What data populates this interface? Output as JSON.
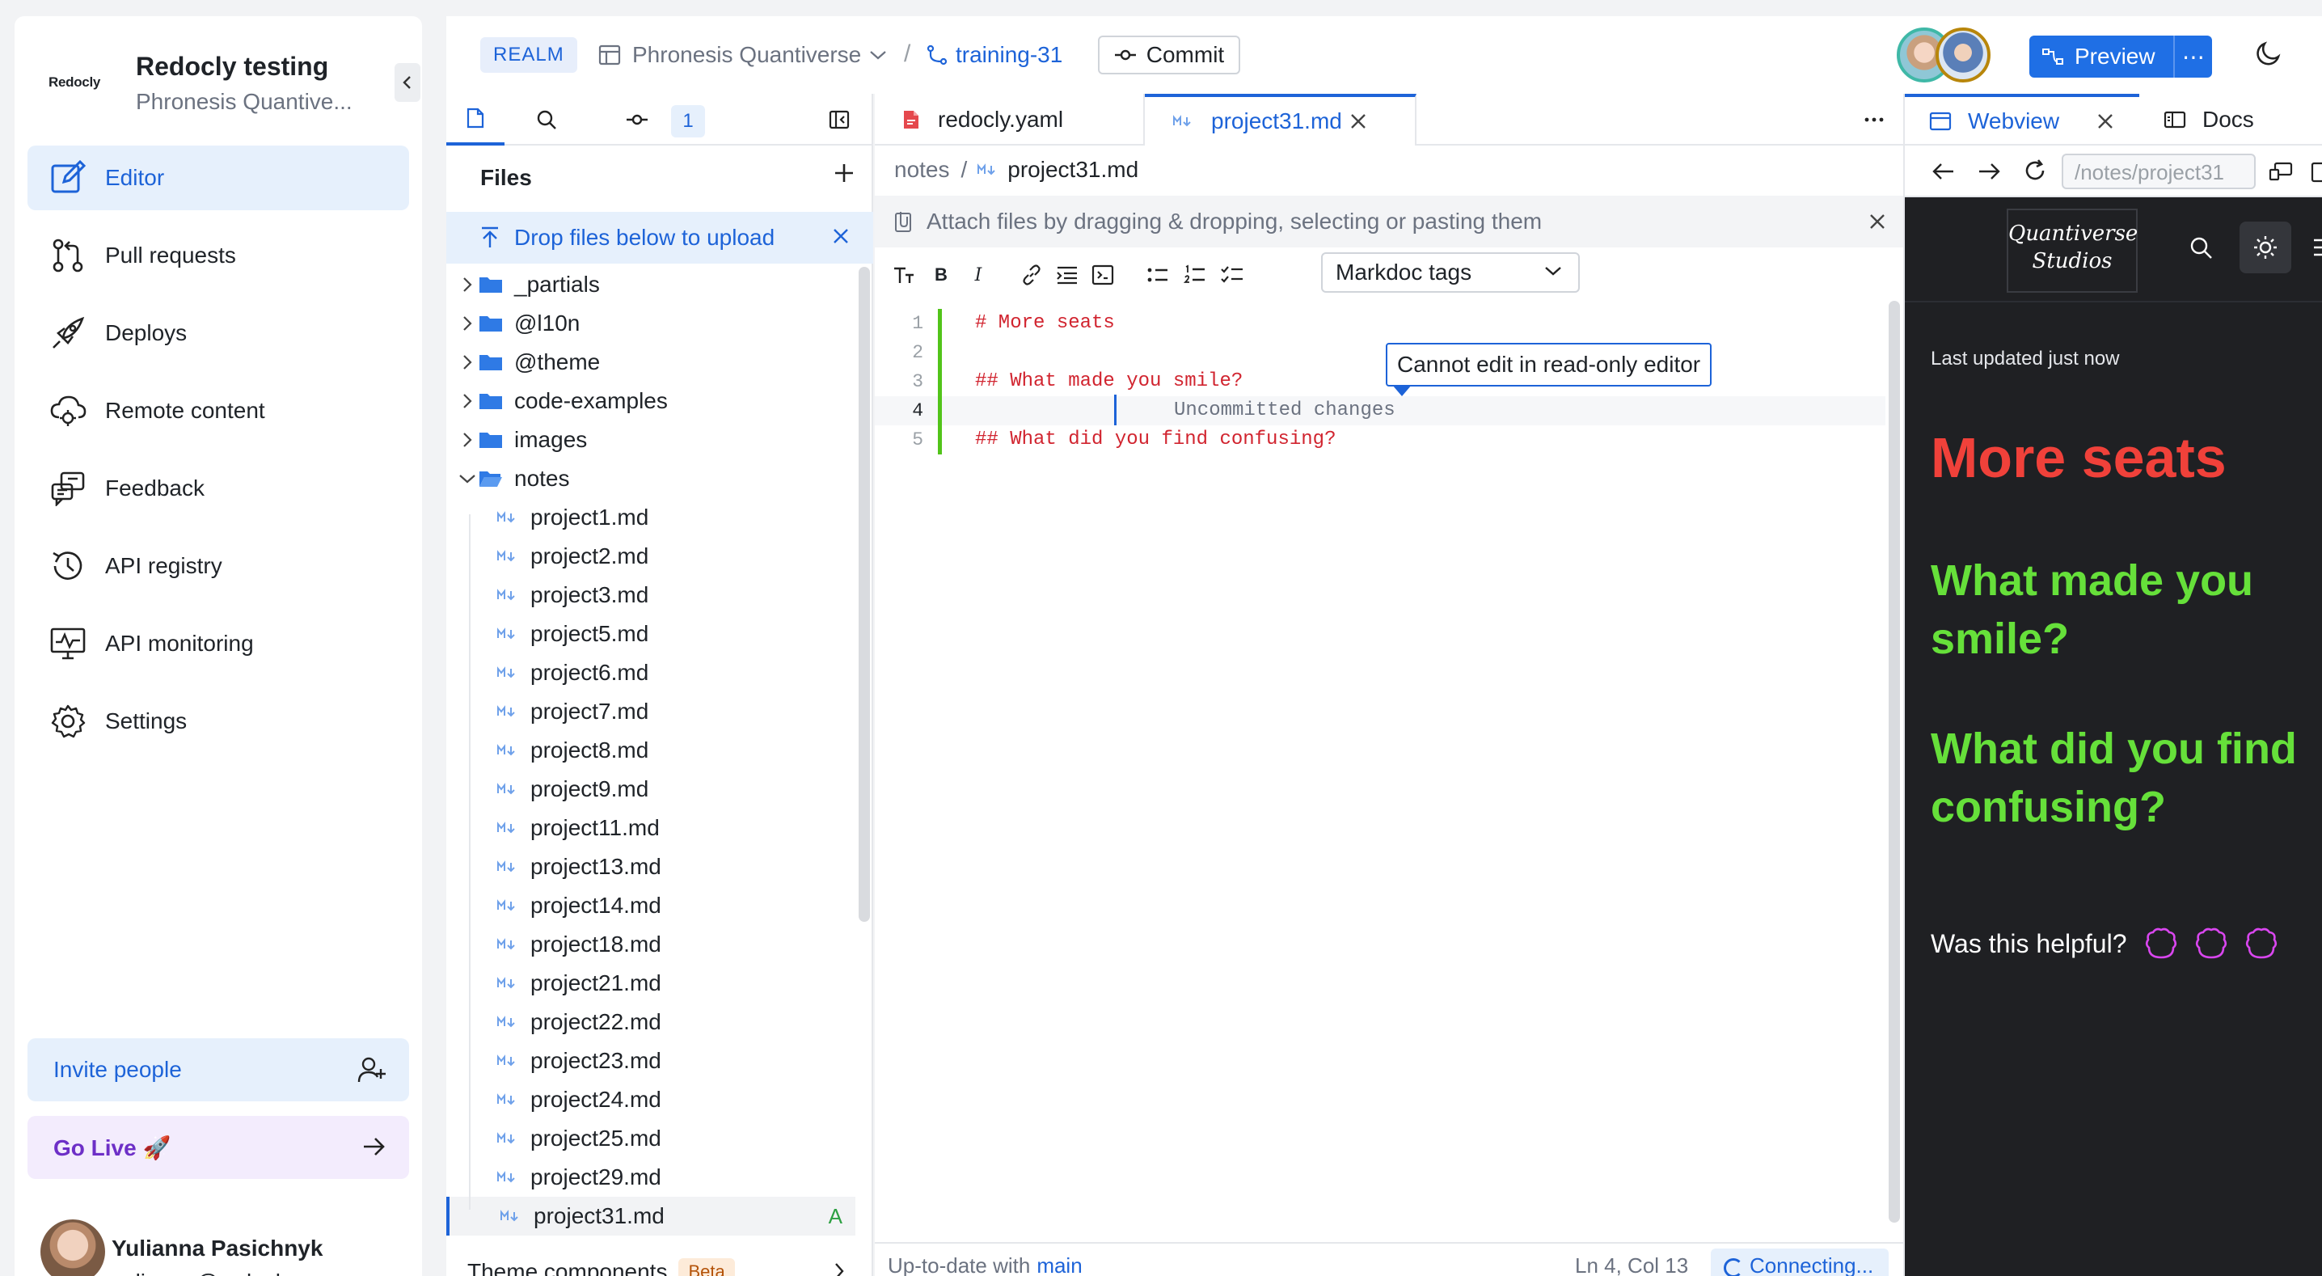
{
  "sidebar": {
    "org_logo": "Redocly",
    "org_name": "Redocly testing",
    "org_sub": "Phronesis Quantive...",
    "items": [
      {
        "label": "Editor",
        "icon": "edit-icon",
        "active": true
      },
      {
        "label": "Pull requests",
        "icon": "pull-request-icon"
      },
      {
        "label": "Deploys",
        "icon": "rocket-icon"
      },
      {
        "label": "Remote content",
        "icon": "cloud-icon"
      },
      {
        "label": "Feedback",
        "icon": "feedback-icon"
      },
      {
        "label": "API registry",
        "icon": "history-icon"
      },
      {
        "label": "API monitoring",
        "icon": "monitor-icon"
      },
      {
        "label": "Settings",
        "icon": "gear-icon"
      }
    ],
    "invite_label": "Invite people",
    "golive_label": "Go Live 🚀",
    "user_name": "Yulianna Pasichnyk",
    "user_email": "yulianna@redocly.com"
  },
  "topbar": {
    "realm": "REALM",
    "project": "Phronesis Quantiverse",
    "branch": "training-31",
    "commit_label": "Commit",
    "preview_label": "Preview",
    "accent": "#1f6fe5"
  },
  "files": {
    "changes_count": "1",
    "title": "Files",
    "upload_hint": "Drop files below to upload",
    "folders": [
      "_partials",
      "@l10n",
      "@theme",
      "code-examples",
      "images"
    ],
    "open_folder": "notes",
    "files": [
      "project1.md",
      "project2.md",
      "project3.md",
      "project5.md",
      "project6.md",
      "project7.md",
      "project8.md",
      "project9.md",
      "project11.md",
      "project13.md",
      "project14.md",
      "project18.md",
      "project21.md",
      "project22.md",
      "project23.md",
      "project24.md",
      "project25.md",
      "project29.md"
    ],
    "selected_file": "project31.md",
    "selected_status": "A",
    "theme_components": "Theme components",
    "beta": "Beta"
  },
  "editor": {
    "tab1": "redocly.yaml",
    "tab2": "project31.md",
    "crumb_folder": "notes",
    "crumb_sep": "/",
    "crumb_file": "project31.md",
    "attach_hint": "Attach files by dragging & dropping, selecting or pasting them",
    "markdoc_tags": "Markdoc tags",
    "line_numbers": [
      "1",
      "2",
      "3",
      "4",
      "5"
    ],
    "lines": [
      "# More seats",
      "",
      "## What made you smile?",
      "",
      "## What did you find confusing?"
    ],
    "ghost_text": "Uncommitted changes",
    "tooltip": "Cannot edit in read-only editor",
    "status_left": "Up-to-date with",
    "status_branch": "main",
    "status_pos": "Ln 4, Col 13",
    "status_conn": "Connecting..."
  },
  "preview": {
    "tab_webview": "Webview",
    "tab_docs": "Docs",
    "url": "/notes/project31",
    "logo_line1": "Quantiverse",
    "logo_line2": "Studios",
    "updated": "Last updated just now",
    "h1": "More seats",
    "h2a": "What made you smile?",
    "h2b": "What did you find confusing?",
    "helpful": "Was this helpful?",
    "h1_color": "#f0413a",
    "h2_color": "#66e03a"
  }
}
